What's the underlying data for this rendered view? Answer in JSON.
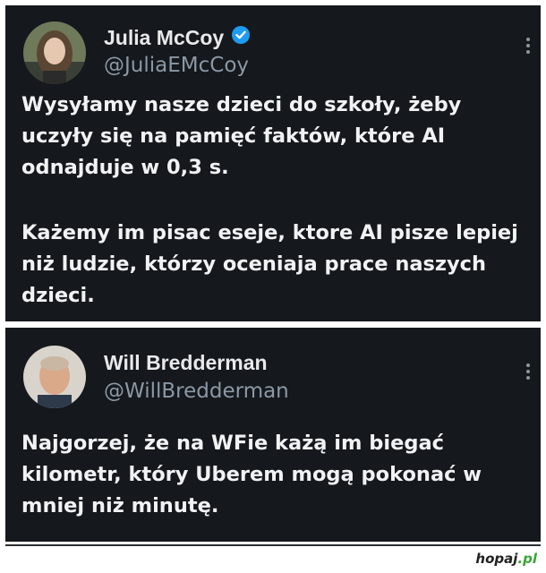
{
  "posts": [
    {
      "author_name": "Julia McCoy",
      "verified": true,
      "handle": "@JuliaEMcCoy",
      "paragraphs": [
        "Wysyłamy nasze dzieci do szkoły, żeby uczyły się na pamięć faktów, które AI odnajduje w 0,3 s.",
        "Każemy im pisac eseje, ktore AI pisze lepiej niż ludzie, którzy oceniaja prace naszych dzieci."
      ]
    },
    {
      "author_name": "Will Bredderman",
      "verified": false,
      "handle": "@WillBredderman",
      "paragraphs": [
        "Najgorzej, że na WFie każą im biegać kilometr, który Uberem mogą pokonać w mniej niż minutę."
      ]
    }
  ],
  "watermark": {
    "name": "hopaj",
    "tld": ".pl"
  },
  "colors": {
    "card_background": "#15181c",
    "verified_badge": "#1d9bf0",
    "handle_text": "#8b98a5"
  },
  "icons": [
    "verified-badge-icon",
    "more-options-icon"
  ]
}
